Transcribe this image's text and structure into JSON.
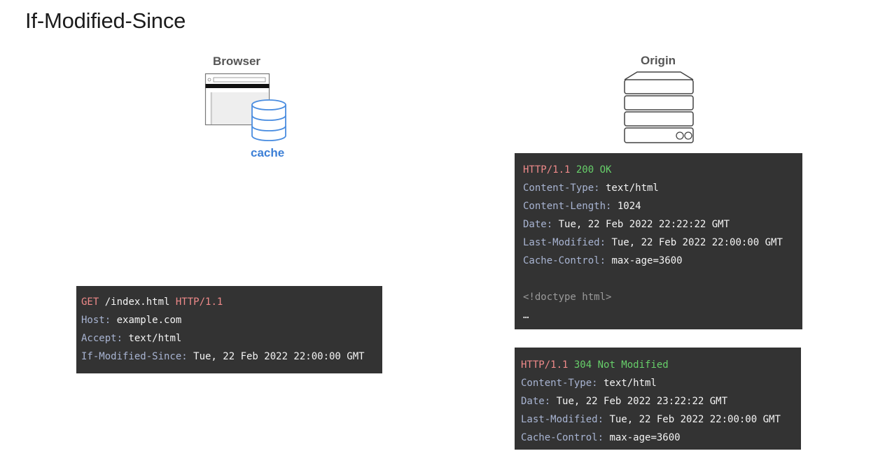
{
  "title": "If-Modified-Since",
  "browser": {
    "label": "Browser",
    "cache_label": "cache"
  },
  "origin": {
    "label": "Origin"
  },
  "request": {
    "method": "GET",
    "path": " /index.html ",
    "protocol": "HTTP/1.1",
    "headers": [
      {
        "key": "Host:",
        "value": " example.com"
      },
      {
        "key": "Accept:",
        "value": " text/html"
      },
      {
        "key": "If-Modified-Since:",
        "value": " Tue, 22 Feb 2022 22:00:00 GMT"
      }
    ]
  },
  "response_200": {
    "protocol": "HTTP/1.1",
    "status": " 200 OK",
    "headers": [
      {
        "key": "Content-Type:",
        "value": " text/html"
      },
      {
        "key": "Content-Length:",
        "value": " 1024"
      },
      {
        "key": "Date:",
        "value": " Tue, 22 Feb 2022 22:22:22 GMT"
      },
      {
        "key": "Last-Modified:",
        "value": " Tue, 22 Feb 2022 22:00:00 GMT"
      },
      {
        "key": "Cache-Control:",
        "value": " max-age=3600"
      }
    ],
    "body_line1": "<!doctype html>",
    "body_line2": "…"
  },
  "response_304": {
    "protocol": "HTTP/1.1",
    "status": " 304 Not Modified",
    "headers": [
      {
        "key": "Content-Type:",
        "value": " text/html"
      },
      {
        "key": "Date:",
        "value": " Tue, 22 Feb 2022 23:22:22 GMT"
      },
      {
        "key": "Last-Modified:",
        "value": " Tue, 22 Feb 2022 22:00:00 GMT"
      },
      {
        "key": "Cache-Control:",
        "value": " max-age=3600"
      }
    ]
  },
  "icons": [
    "browser-window-icon",
    "cache-database-icon",
    "server-stack-icon"
  ],
  "colors": {
    "code_bg": "#333333",
    "protocol": "#ef8a8a",
    "status_ok": "#67cf6a",
    "header_key": "#a8b4d2",
    "cache_blue": "#3c7fd6"
  }
}
